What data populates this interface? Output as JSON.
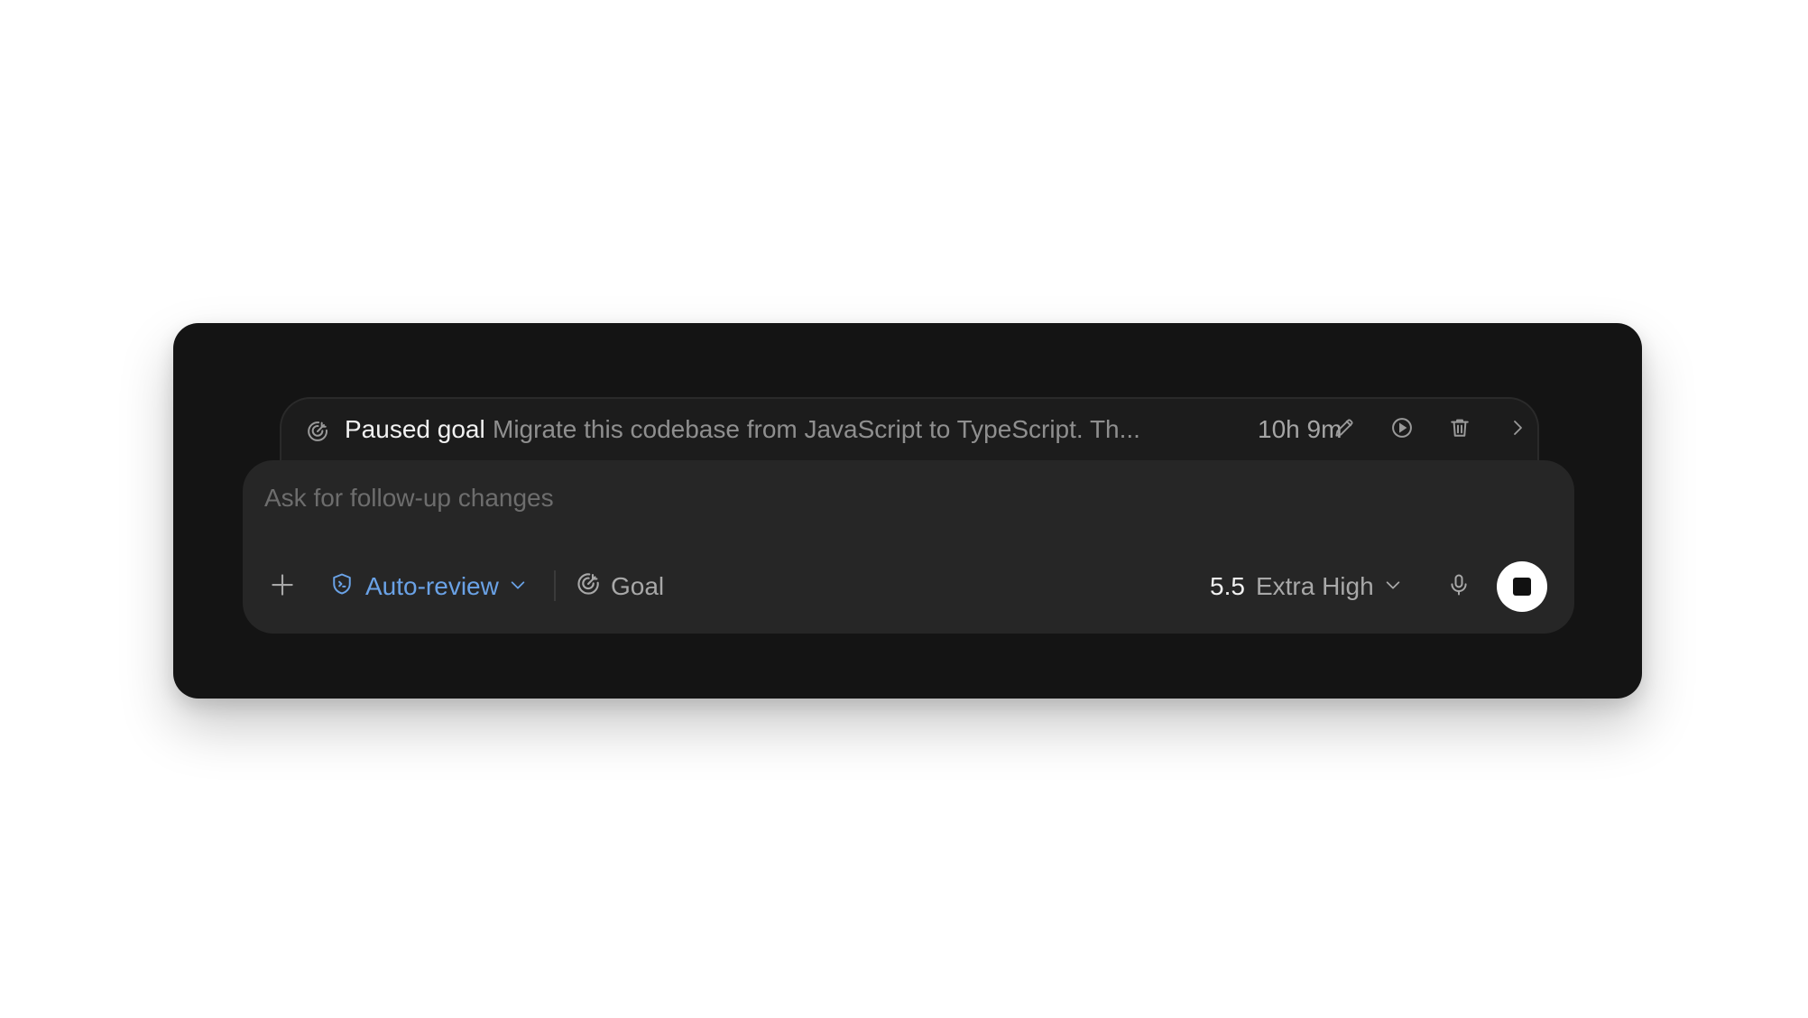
{
  "goal_bar": {
    "status_label": "Paused goal",
    "description": "Migrate this codebase from JavaScript to TypeScript. Th...",
    "elapsed": "10h 9m",
    "icons": [
      "goal-icon",
      "pencil-icon",
      "play-circle-icon",
      "trash-icon",
      "chevron-right-icon"
    ]
  },
  "composer": {
    "placeholder": "Ask for follow-up changes",
    "value": ""
  },
  "toolbar": {
    "review_mode": "Auto-review",
    "goal_label": "Goal",
    "model_version": "5.5",
    "effort_level": "Extra High",
    "icons": [
      "plus-icon",
      "shield-icon",
      "chevron-down-icon",
      "goal-icon",
      "microphone-icon",
      "stop-icon"
    ]
  },
  "colors": {
    "window_bg": "#141414",
    "composer_bg": "#262626",
    "accent_blue": "#6aa2e6",
    "muted_text": "#8f8f8f"
  }
}
